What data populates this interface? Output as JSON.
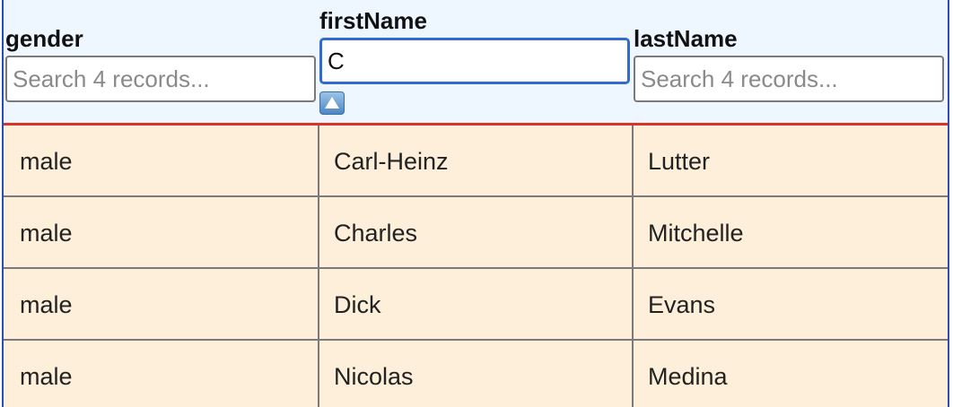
{
  "columns": [
    {
      "title": "gender",
      "search_value": "",
      "search_placeholder": "Search 4 records..."
    },
    {
      "title": "firstName",
      "search_value": "C",
      "search_placeholder": "",
      "sort_icon": "sort-ascending-icon"
    },
    {
      "title": "lastName",
      "search_value": "",
      "search_placeholder": "Search 4 records..."
    }
  ],
  "rows": [
    {
      "gender": "male",
      "firstName": "Carl-Heinz",
      "lastName": "Lutter"
    },
    {
      "gender": "male",
      "firstName": "Charles",
      "lastName": "Mitchelle"
    },
    {
      "gender": "male",
      "firstName": "Dick",
      "lastName": "Evans"
    },
    {
      "gender": "male",
      "firstName": "Nicolas",
      "lastName": "Medina"
    }
  ],
  "colors": {
    "header_bg": "#eef6ff",
    "row_bg": "#fdefd9",
    "header_border": "#d9342b",
    "frame_border": "#2b4bb8",
    "active_input_border": "#2f6bd1"
  }
}
